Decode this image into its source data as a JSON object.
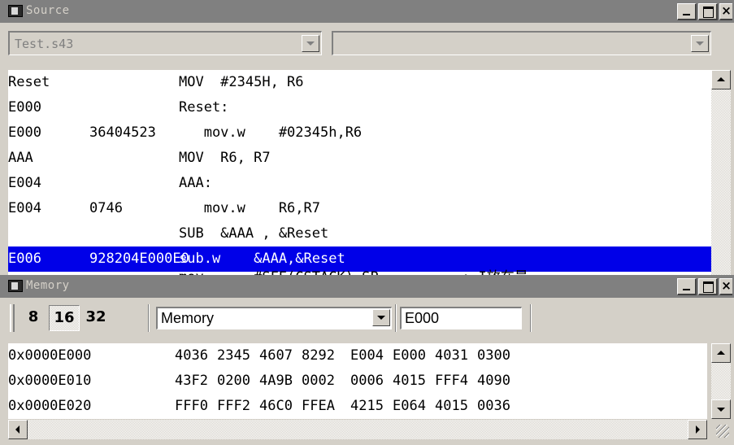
{
  "source_window": {
    "title": "Source",
    "file_combo": "Test.s43",
    "function_combo": "",
    "lines": [
      {
        "c1": "Reset",
        "c2": "",
        "c3": "MOV  #2345H, R6",
        "highlight": false
      },
      {
        "c1": "E000",
        "c2": "",
        "c3": "Reset:",
        "highlight": false
      },
      {
        "c1": "E000",
        "c2": "36404523",
        "c3": "   mov.w    #02345h,R6",
        "highlight": false
      },
      {
        "c1": "AAA",
        "c2": "",
        "c3": "MOV  R6, R7",
        "highlight": false
      },
      {
        "c1": "E004",
        "c2": "",
        "c3": "AAA:",
        "highlight": false
      },
      {
        "c1": "E004",
        "c2": "0746",
        "c3": "   mov.w    R6,R7",
        "highlight": false
      },
      {
        "c1": "",
        "c2": "",
        "c3": "SUB  &AAA , &Reset",
        "highlight": true
      },
      {
        "c1": "E006",
        "c2": "928204E000E0",
        "c3": "sub.w    &AAA,&Reset",
        "highlight": true
      },
      {
        "c1": "",
        "c2": "",
        "c3": "mov      #SFE(CSTACK),SP          ; I放在最",
        "highlight": false
      }
    ]
  },
  "memory_window": {
    "title": "Memory",
    "width_buttons": [
      "8",
      "16",
      "32"
    ],
    "selected_width": "16",
    "zone_combo": "Memory",
    "address_input": "E000",
    "rows": [
      {
        "address": "0x0000E000",
        "words": [
          "4036",
          "2345",
          "4607",
          "8292",
          "E004",
          "E000",
          "4031",
          "0300"
        ]
      },
      {
        "address": "0x0000E010",
        "words": [
          "43F2",
          "0200",
          "4A9B",
          "0002",
          "0006",
          "4015",
          "FFF4",
          "4090"
        ]
      },
      {
        "address": "0x0000E020",
        "words": [
          "FFF0",
          "FFF2",
          "46C0",
          "FFEA",
          "4215",
          "E064",
          "4015",
          "0036"
        ]
      }
    ]
  },
  "colors": {
    "titlebar_inactive": "#808080",
    "highlight": "#0000e8",
    "face": "#d4d0c8"
  }
}
